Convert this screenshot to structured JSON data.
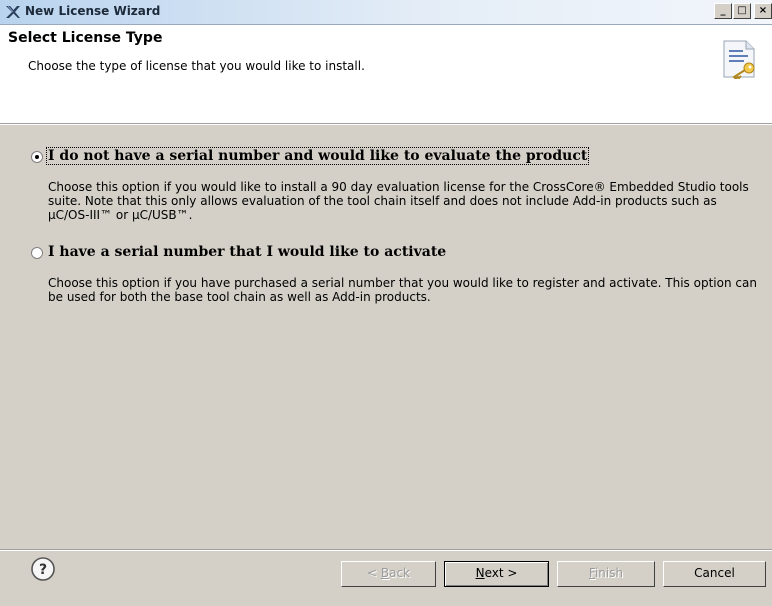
{
  "window": {
    "title": "New License Wizard",
    "icon": "x-icon",
    "controls": {
      "minimize": "_",
      "maximize": "□",
      "close": "×"
    }
  },
  "header": {
    "title": "Select License Type",
    "description": "Choose the type of license that you would like to install.",
    "icon": "license-document-key-icon"
  },
  "options": [
    {
      "label": "I do not have a serial number and would like to evaluate the product",
      "selected": true,
      "description": "Choose this option if you would like to install a 90 day evaluation license for the CrossCore® Embedded Studio tools suite. Note that this only allows evaluation of the tool chain itself and does not include Add-in products such as µC/OS-III™ or µC/USB™."
    },
    {
      "label": "I have a serial number that I would like to activate",
      "selected": false,
      "description": "Choose this option if you have purchased a serial number that you would like to register and activate. This option can be used for both the base tool chain as well as Add-in products."
    }
  ],
  "footer": {
    "help_icon": "help-question-icon",
    "buttons": {
      "back": {
        "prefix": "< ",
        "mnemonic": "B",
        "rest": "ack",
        "enabled": false
      },
      "next": {
        "mnemonic": "N",
        "rest": "ext >",
        "enabled": true
      },
      "finish": {
        "mnemonic": "F",
        "rest": "inish",
        "enabled": false
      },
      "cancel": {
        "label": "Cancel",
        "enabled": true
      }
    }
  }
}
